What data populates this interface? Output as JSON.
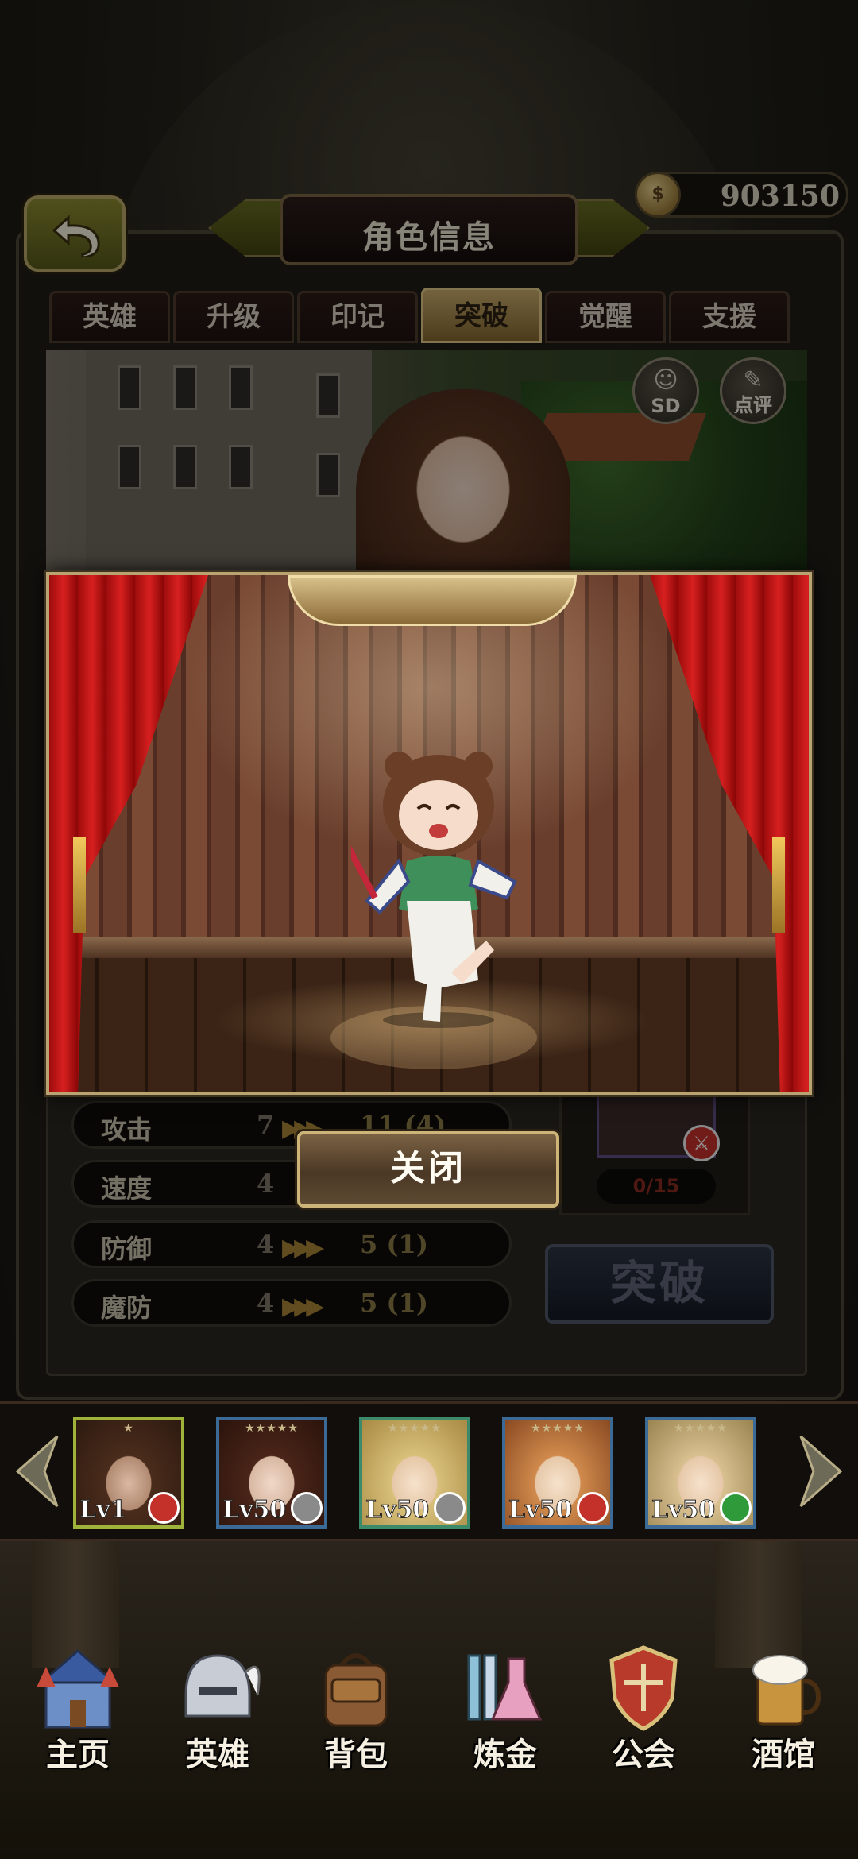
{
  "header": {
    "title": "角色信息",
    "gold": "903150",
    "gold_icon_glyph": "$"
  },
  "tabs": [
    {
      "label": "英雄",
      "active": false
    },
    {
      "label": "升级",
      "active": false
    },
    {
      "label": "印记",
      "active": false
    },
    {
      "label": "突破",
      "active": true
    },
    {
      "label": "觉醒",
      "active": false
    },
    {
      "label": "支援",
      "active": false
    }
  ],
  "banner": {
    "sd_label": "SD",
    "review_label": "点评"
  },
  "stats": [
    {
      "name": "攻击",
      "current": "7",
      "next": "11 (4)"
    },
    {
      "name": "速度",
      "current": "4",
      "next": ""
    },
    {
      "name": "防御",
      "current": "4",
      "next": "5 (1)"
    },
    {
      "name": "魔防",
      "current": "4",
      "next": "5 (1)"
    }
  ],
  "material": {
    "count": "0/15"
  },
  "break_button": "突破",
  "modal": {
    "close_label": "关闭"
  },
  "hero_strip": [
    {
      "level": "Lv1",
      "stars": "★",
      "frame": "#9fb33a",
      "element": "#c3312a"
    },
    {
      "level": "Lv50",
      "stars": "★★★★★",
      "frame": "#3c6a96",
      "element": "#8a8a8a"
    },
    {
      "level": "Lv50",
      "stars": "★★★★★",
      "frame": "#3c8a6a",
      "element": "#8a8a8a"
    },
    {
      "level": "Lv50",
      "stars": "★★★★★",
      "frame": "#3c6a96",
      "element": "#c3312a"
    },
    {
      "level": "Lv50",
      "stars": "★★★★★",
      "frame": "#3c6a96",
      "element": "#2e9a3a"
    }
  ],
  "nav": [
    {
      "label": "主页",
      "icon": "castle-icon"
    },
    {
      "label": "英雄",
      "icon": "helmet-icon"
    },
    {
      "label": "背包",
      "icon": "backpack-icon"
    },
    {
      "label": "炼金",
      "icon": "flask-icon"
    },
    {
      "label": "公会",
      "icon": "guild-shield-icon"
    },
    {
      "label": "酒馆",
      "icon": "beer-mug-icon"
    }
  ],
  "colors": {
    "accent_gold": "#cdb57a",
    "active_tab": "#c8aa6c",
    "curtain_red": "#d72020"
  }
}
